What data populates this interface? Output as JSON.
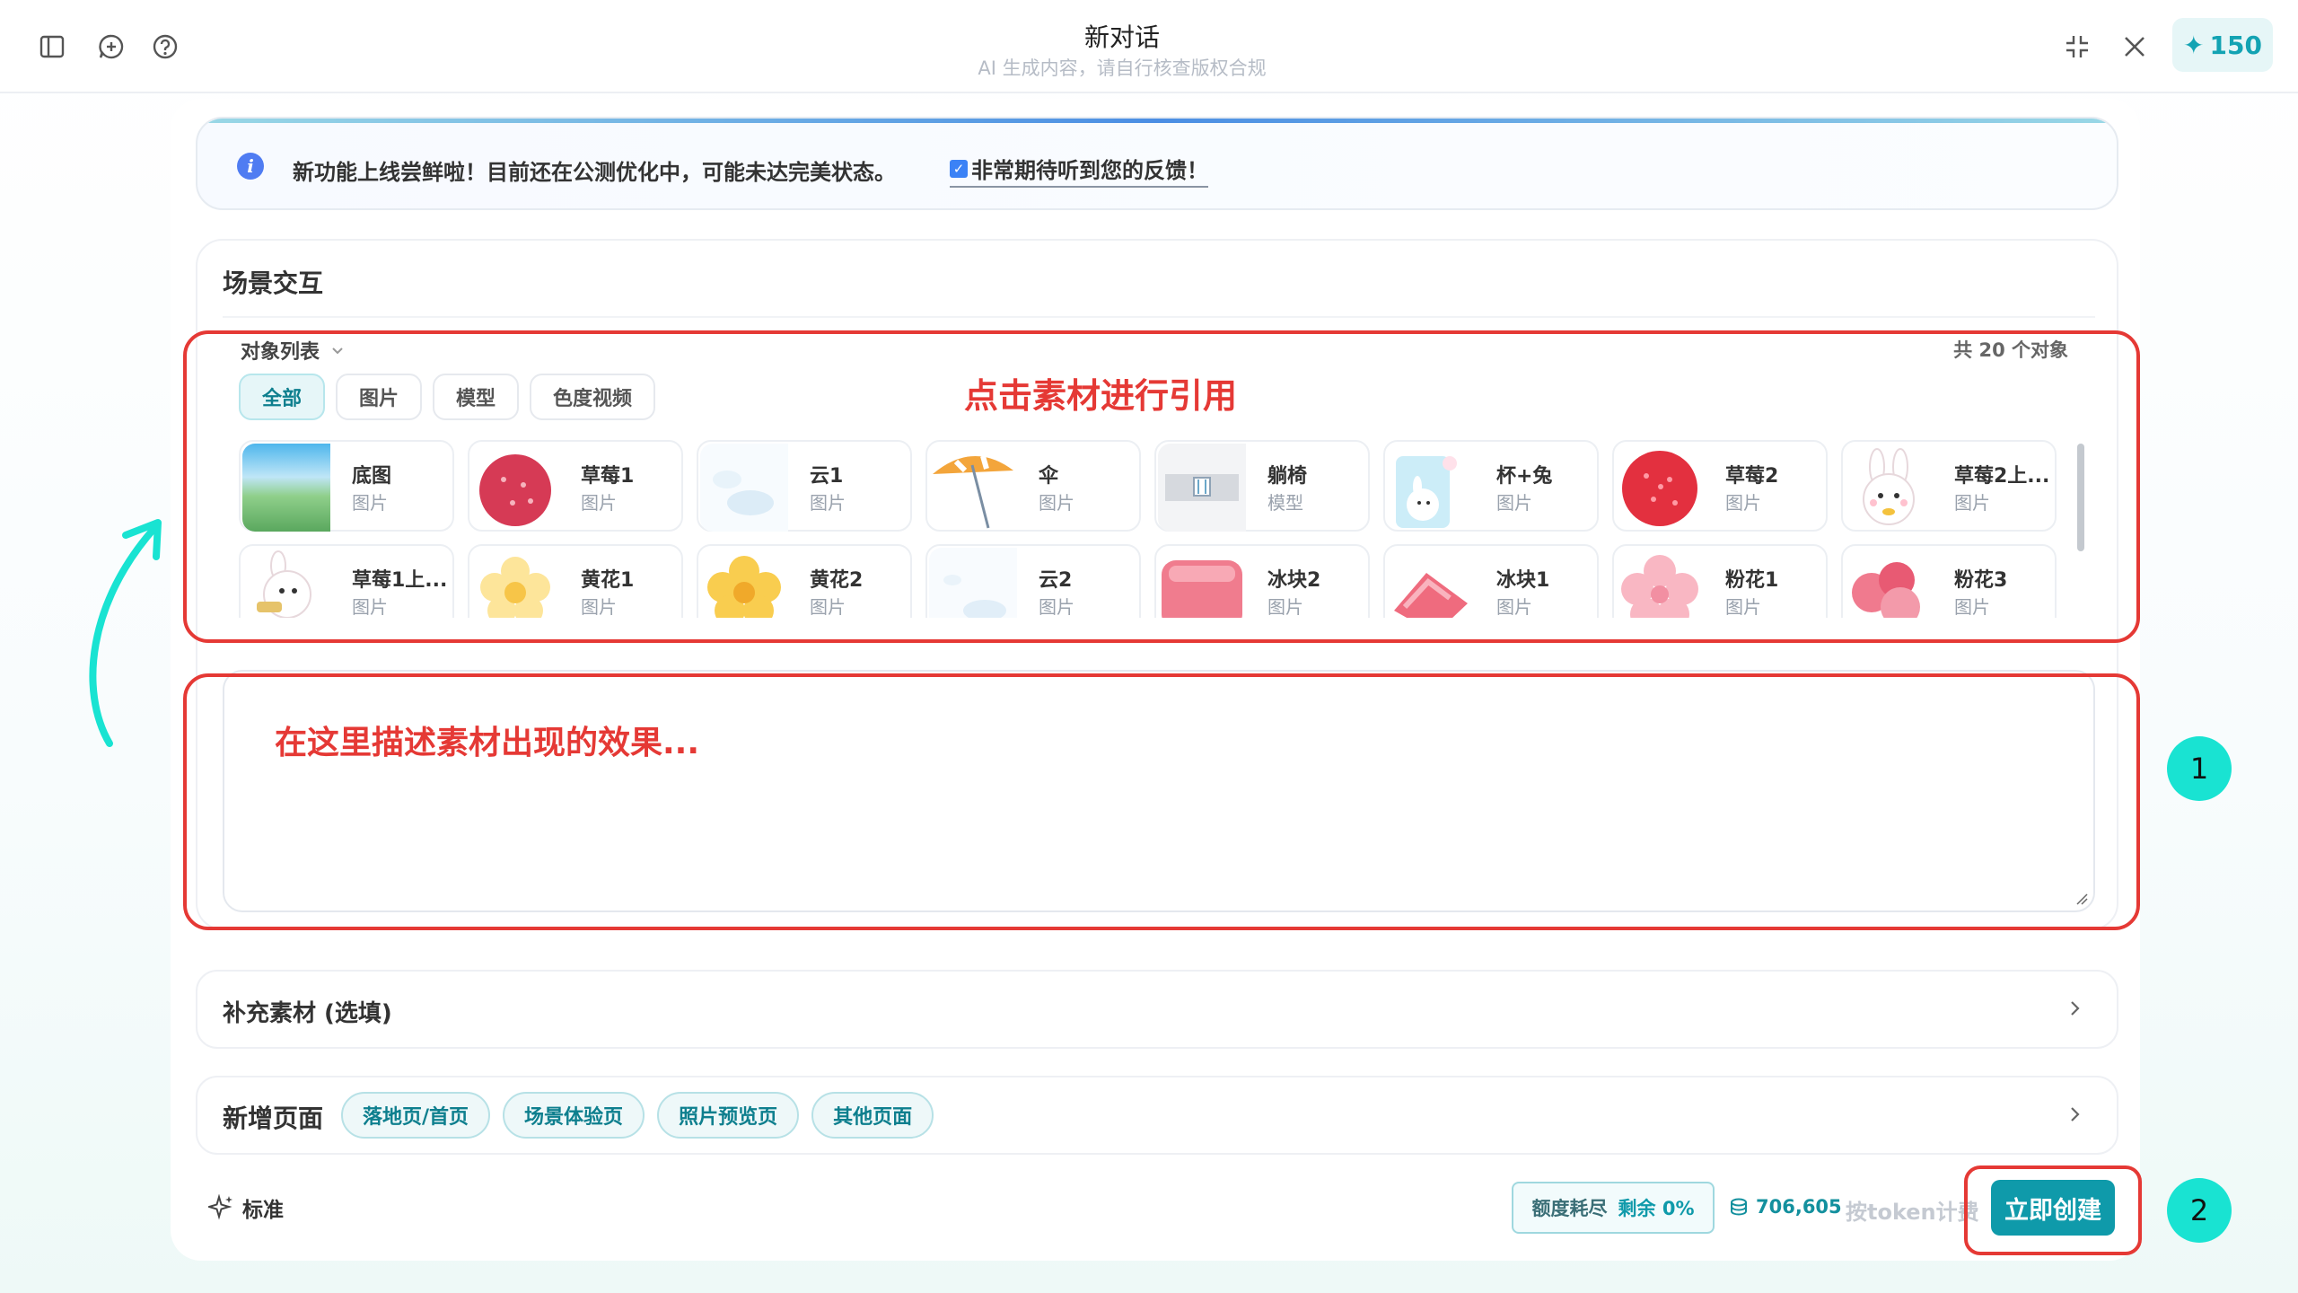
{
  "header": {
    "title": "新对话",
    "subtitle": "AI 生成内容，请自行核查版权合规",
    "credits": "150"
  },
  "notice": {
    "text": "新功能上线尝鲜啦！目前还在公测优化中，可能未达完美状态。",
    "link": "非常期待听到您的反馈！"
  },
  "scene": {
    "title": "场景交互",
    "object_list_label": "对象列表",
    "object_count": "共 20 个对象",
    "filters": [
      "全部",
      "图片",
      "模型",
      "色度视频"
    ],
    "objects": [
      {
        "name": "底图",
        "type": "图片"
      },
      {
        "name": "草莓1",
        "type": "图片"
      },
      {
        "name": "云1",
        "type": "图片"
      },
      {
        "name": "伞",
        "type": "图片"
      },
      {
        "name": "躺椅",
        "type": "模型"
      },
      {
        "name": "杯+兔",
        "type": "图片"
      },
      {
        "name": "草莓2",
        "type": "图片"
      },
      {
        "name": "草莓2上...",
        "type": "图片"
      },
      {
        "name": "草莓1上...",
        "type": "图片"
      },
      {
        "name": "黄花1",
        "type": "图片"
      },
      {
        "name": "黄花2",
        "type": "图片"
      },
      {
        "name": "云2",
        "type": "图片"
      },
      {
        "name": "冰块2",
        "type": "图片"
      },
      {
        "name": "冰块1",
        "type": "图片"
      },
      {
        "name": "粉花1",
        "type": "图片"
      },
      {
        "name": "粉花3",
        "type": "图片"
      }
    ],
    "description_placeholder": "在这里描述素材出现的效果..."
  },
  "annotation": {
    "callout": "点击素材进行引用",
    "badge1": "1",
    "badge2": "2"
  },
  "supplement": {
    "title": "补充素材 (选填)"
  },
  "pages": {
    "title": "新增页面",
    "tags": [
      "落地页/首页",
      "场景体验页",
      "照片预览页",
      "其他页面"
    ]
  },
  "footer": {
    "mode": "标准",
    "quota_label": "额度耗尽",
    "quota_remaining": "剩余 0%",
    "tokens": "706,605",
    "billing": "按token计费",
    "create_button": "立即创建"
  },
  "colors": {
    "accent": "#0f9aaa",
    "annotation_red": "#e53935",
    "badge_cyan": "#19e3d2"
  }
}
